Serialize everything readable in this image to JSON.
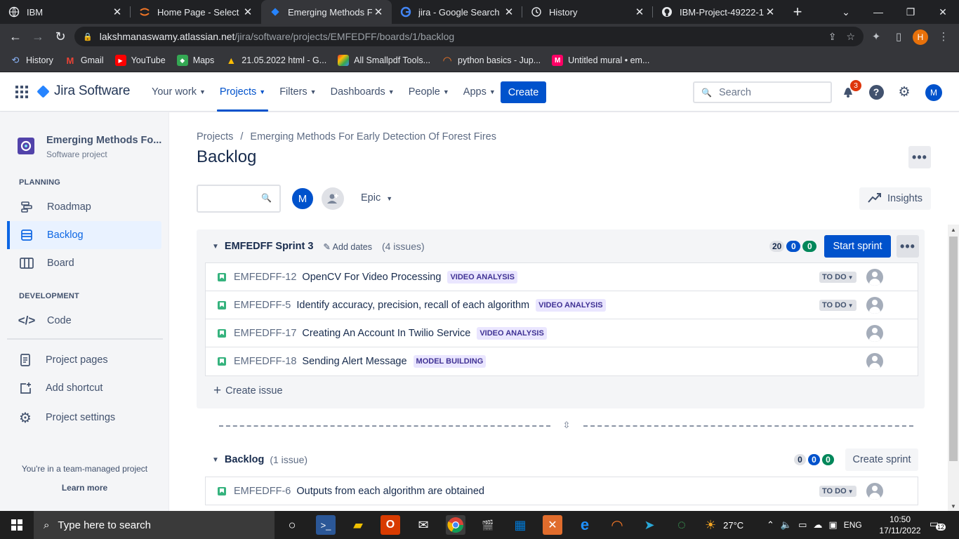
{
  "browser": {
    "tabs": [
      {
        "title": "IBM",
        "icon": "ibm-icon"
      },
      {
        "title": "Home Page - Select or",
        "icon": "jupyter-icon"
      },
      {
        "title": "Emerging Methods Fo",
        "icon": "jira-icon",
        "active": true
      },
      {
        "title": "jira - Google Search",
        "icon": "google-icon"
      },
      {
        "title": "History",
        "icon": "history-icon"
      },
      {
        "title": "IBM-Project-49222-16",
        "icon": "github-icon"
      }
    ],
    "url_host": "lakshmanaswamy.atlassian.net",
    "url_path": "/jira/software/projects/EMFEDFF/boards/1/backlog",
    "profile_initial": "H",
    "bookmarks": [
      {
        "label": "History",
        "icon": "history-icon",
        "color": "#8ab4f8"
      },
      {
        "label": "Gmail",
        "icon": "gmail-icon",
        "color": "#ea4335"
      },
      {
        "label": "YouTube",
        "icon": "youtube-icon",
        "color": "#ff0000"
      },
      {
        "label": "Maps",
        "icon": "maps-icon",
        "color": "#34a853"
      },
      {
        "label": "21.05.2022 html - G...",
        "icon": "drive-icon",
        "color": "#fbbc04"
      },
      {
        "label": "All Smallpdf Tools...",
        "icon": "smallpdf-icon",
        "color": "#e5322d"
      },
      {
        "label": "python basics - Jup...",
        "icon": "jupyter-icon",
        "color": "#f37626"
      },
      {
        "label": "Untitled mural • em...",
        "icon": "mural-icon",
        "color": "#ff0066"
      }
    ]
  },
  "header": {
    "product": "Jira Software",
    "nav": [
      {
        "label": "Your work",
        "active": false
      },
      {
        "label": "Projects",
        "active": true
      },
      {
        "label": "Filters",
        "active": false
      },
      {
        "label": "Dashboards",
        "active": false
      },
      {
        "label": "People",
        "active": false
      },
      {
        "label": "Apps",
        "active": false
      }
    ],
    "create_label": "Create",
    "search_placeholder": "Search",
    "notification_count": "3",
    "user_initial": "M"
  },
  "sidebar": {
    "project_name": "Emerging Methods Fo...",
    "project_type": "Software project",
    "planning_label": "PLANNING",
    "roadmap": "Roadmap",
    "backlog": "Backlog",
    "board": "Board",
    "development_label": "DEVELOPMENT",
    "code": "Code",
    "project_pages": "Project pages",
    "add_shortcut": "Add shortcut",
    "project_settings": "Project settings",
    "team_managed": "You're in a team-managed project",
    "learn_more": "Learn more"
  },
  "main": {
    "breadcrumb_root": "Projects",
    "breadcrumb_project": "Emerging Methods For Early Detection Of Forest Fires",
    "title": "Backlog",
    "member_initial": "M",
    "epic_label": "Epic",
    "insights_label": "Insights",
    "sprint": {
      "name": "EMFEDFF Sprint 3",
      "add_dates": "Add dates",
      "count": "(4 issues)",
      "points": [
        "20",
        "0",
        "0"
      ],
      "start_label": "Start sprint",
      "issues": [
        {
          "key": "EMFEDFF-12",
          "summary": "OpenCV For Video Processing",
          "epic": "VIDEO ANALYSIS",
          "status": "TO DO"
        },
        {
          "key": "EMFEDFF-5",
          "summary": "Identify accuracy, precision, recall of each algorithm",
          "epic": "VIDEO ANALYSIS",
          "status": "TO DO"
        },
        {
          "key": "EMFEDFF-17",
          "summary": "Creating An Account In Twilio Service",
          "epic": "VIDEO ANALYSIS",
          "status": ""
        },
        {
          "key": "EMFEDFF-18",
          "summary": "Sending Alert Message",
          "epic": "MODEL BUILDING",
          "status": ""
        }
      ],
      "create_issue": "Create issue"
    },
    "backlog": {
      "name": "Backlog",
      "count": "(1 issue)",
      "points": [
        "0",
        "0",
        "0"
      ],
      "create_sprint": "Create sprint",
      "issues": [
        {
          "key": "EMFEDFF-6",
          "summary": "Outputs from each algorithm are obtained",
          "status": "TO DO"
        }
      ]
    }
  },
  "taskbar": {
    "search_placeholder": "Type here to search",
    "weather": "27°C",
    "language": "ENG",
    "time": "10:50",
    "date": "17/11/2022",
    "notifications": "12",
    "chrome_badge": "97"
  }
}
